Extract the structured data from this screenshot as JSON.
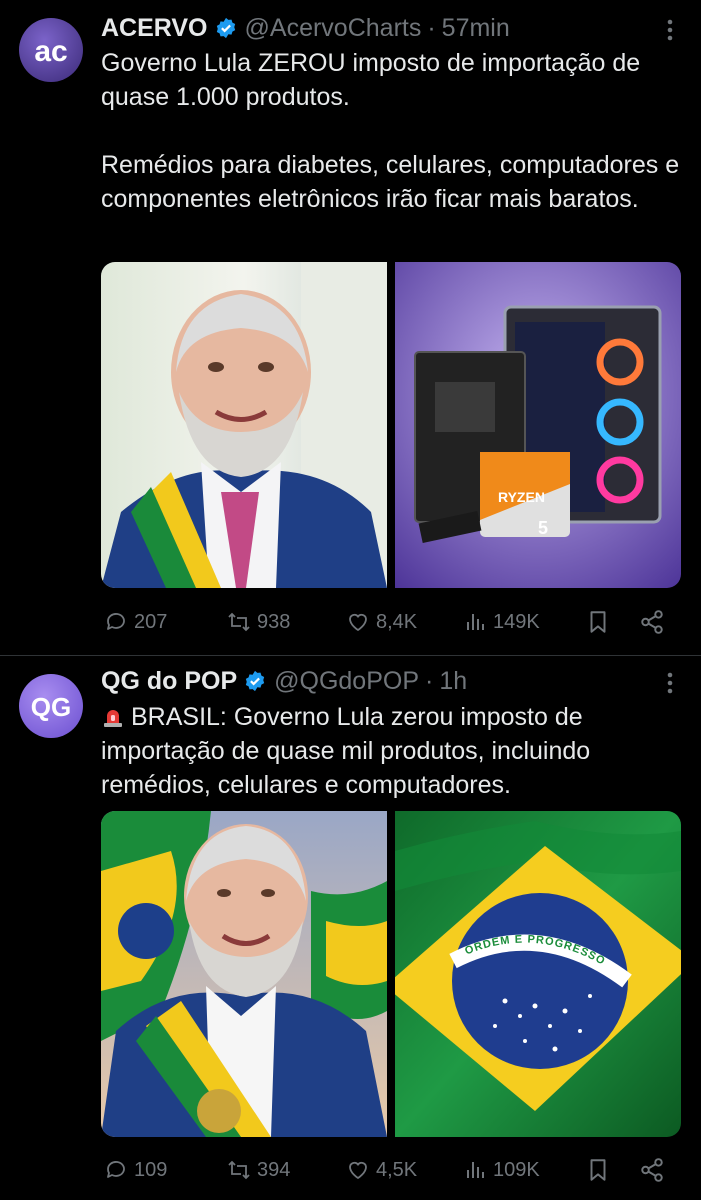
{
  "tweets": [
    {
      "author_name": "ACERVO",
      "handle": "@AcervoCharts",
      "separator": "·",
      "time": "57min",
      "avatar_text": "ac",
      "text_lines": [
        "Governo Lula ZEROU imposto de importação de quase 1.000 produtos.",
        "Remédios para diabetes, celulares, computadores e componentes eletrônicos irão ficar mais baratos."
      ],
      "image_labels": [
        "RYZEN",
        "5"
      ],
      "stats": {
        "replies": "207",
        "reposts": "938",
        "likes": "8,4K",
        "views": "149K"
      }
    },
    {
      "author_name": "QG do POP",
      "handle": "@QGdoPOP",
      "separator": "·",
      "time": "1h",
      "avatar_text": "QG",
      "alert_emoji": "siren-icon",
      "text": "BRASIL: Governo Lula zerou imposto de importação de quase mil produtos, incluindo remédios, celulares e computadores.",
      "image_labels": [
        "ORDEM E PROGRESSO"
      ],
      "stats": {
        "replies": "109",
        "reposts": "394",
        "likes": "4,5K",
        "views": "109K"
      }
    }
  ],
  "colors": {
    "background": "#000000",
    "text": "#e7e9ea",
    "muted": "#71767b",
    "verified": "#1d9bf0",
    "divider": "#2f3336"
  }
}
